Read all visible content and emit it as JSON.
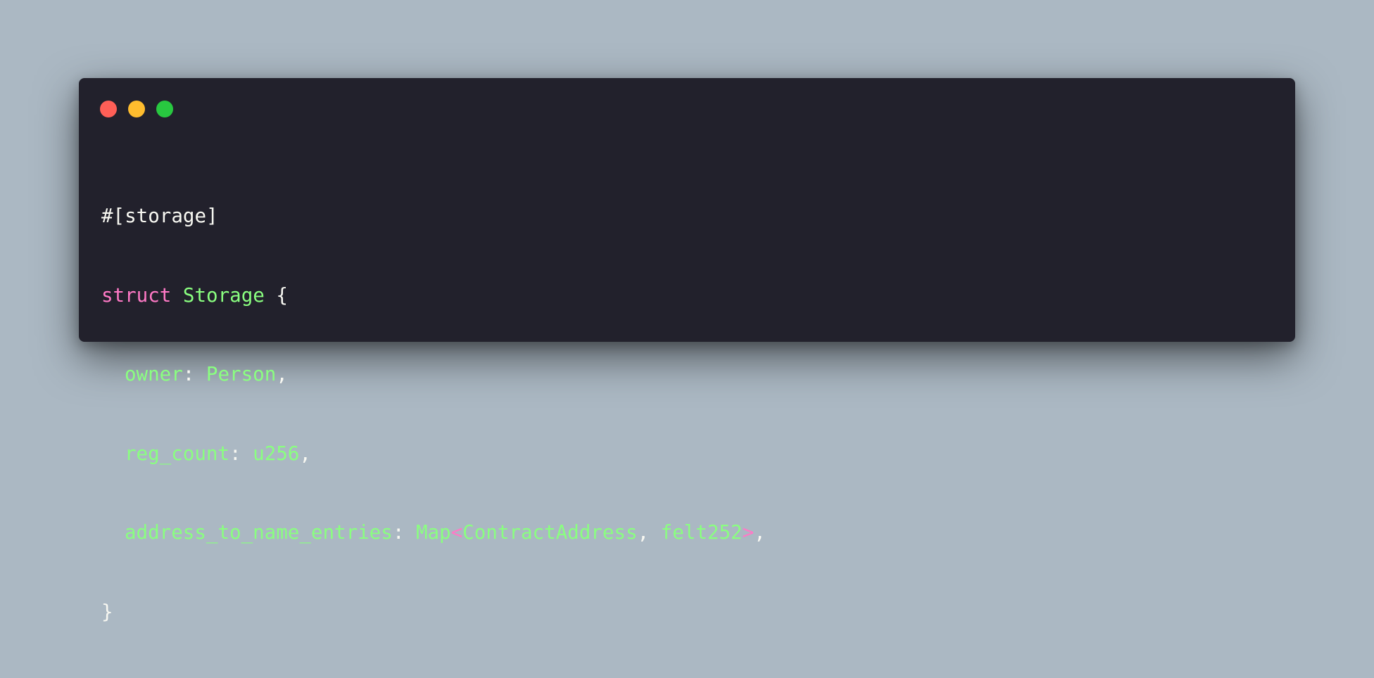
{
  "window": {
    "controls": {
      "close_color": "#ff5f57",
      "minimize_color": "#febc2e",
      "maximize_color": "#28c840"
    }
  },
  "code": {
    "attribute": "#[storage]",
    "struct_keyword": "struct",
    "struct_name": "Storage",
    "open_brace": "{",
    "fields": [
      {
        "name": "owner",
        "colon": ":",
        "type": "Person",
        "comma": ","
      },
      {
        "name": "reg_count",
        "colon": ":",
        "type": "u256",
        "comma": ","
      },
      {
        "name": "address_to_name_entries",
        "colon": ":",
        "type_base": "Map",
        "lt": "<",
        "type_arg1": "ContractAddress",
        "sep": ", ",
        "type_arg2": "felt252",
        "gt": ">",
        "comma": ","
      }
    ],
    "close_brace": "}"
  },
  "colors": {
    "background": "#abb8c3",
    "window": "#22212c",
    "plain": "#f8f8f2",
    "keyword": "#ff79c6",
    "type": "#8aff80"
  }
}
